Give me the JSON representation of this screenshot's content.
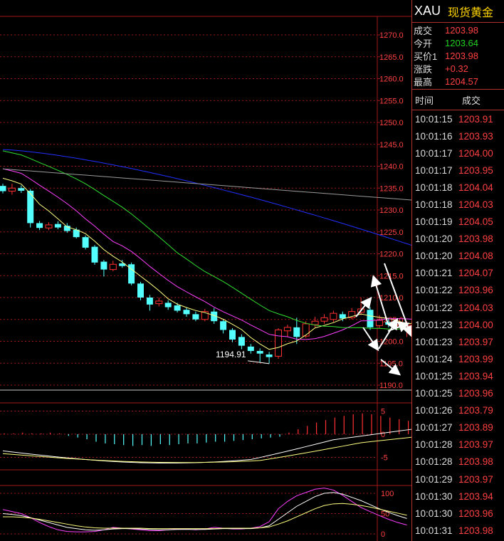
{
  "symbol": "XAU",
  "symbol_name": "现货黄金",
  "quote": [
    {
      "label": "成交",
      "value": "1203.98",
      "color": "#ff4040"
    },
    {
      "label": "今开",
      "value": "1203.64",
      "color": "#21d021"
    },
    {
      "label": "买价1",
      "value": "1203.98",
      "color": "#ff4040"
    },
    {
      "label": "涨跌",
      "value": "+0.32",
      "color": "#ff4040"
    },
    {
      "label": "最高",
      "value": "1204.57",
      "color": "#ff4040"
    }
  ],
  "trades_header": {
    "time": "时间",
    "price": "成交"
  },
  "trades": [
    {
      "time": "10:01:15",
      "price": "1203.91"
    },
    {
      "time": "10:01:16",
      "price": "1203.93"
    },
    {
      "time": "10:01:17",
      "price": "1204.00"
    },
    {
      "time": "10:01:17",
      "price": "1203.95"
    },
    {
      "time": "10:01:18",
      "price": "1204.04"
    },
    {
      "time": "10:01:18",
      "price": "1204.03"
    },
    {
      "time": "10:01:19",
      "price": "1204.05"
    },
    {
      "time": "10:01:20",
      "price": "1203.98"
    },
    {
      "time": "10:01:20",
      "price": "1204.08"
    },
    {
      "time": "10:01:21",
      "price": "1204.07"
    },
    {
      "time": "10:01:22",
      "price": "1203.96"
    },
    {
      "time": "10:01:22",
      "price": "1204.03"
    },
    {
      "time": "10:01:23",
      "price": "1204.00"
    },
    {
      "time": "10:01:23",
      "price": "1203.97"
    },
    {
      "time": "10:01:24",
      "price": "1203.99"
    },
    {
      "time": "10:01:25",
      "price": "1203.94"
    },
    {
      "time": "10:01:25",
      "price": "1203.96"
    },
    {
      "time": "10:01:26",
      "price": "1203.79"
    },
    {
      "time": "10:01:27",
      "price": "1203.89"
    },
    {
      "time": "10:01:28",
      "price": "1203.97"
    },
    {
      "time": "10:01:28",
      "price": "1203.98"
    },
    {
      "time": "10:01:29",
      "price": "1203.97"
    },
    {
      "time": "10:01:30",
      "price": "1203.94"
    },
    {
      "time": "10:01:30",
      "price": "1203.96"
    },
    {
      "time": "10:01:31",
      "price": "1203.98"
    }
  ],
  "chart_data": {
    "type": "candlestick",
    "price_axis": {
      "ticks": [
        "1270.0",
        "1265.0",
        "1260.0",
        "1255.0",
        "1250.0",
        "1245.0",
        "1240.0",
        "1235.0",
        "1230.0",
        "1225.0",
        "1220.0",
        "1215.0",
        "1210.0",
        "1205.0",
        "1200.0",
        "1195.0",
        "1190.0"
      ],
      "range": [
        1190,
        1272
      ]
    },
    "macd_axis": {
      "ticks": [
        "5",
        "0",
        "-5"
      ]
    },
    "kdj_axis": {
      "ticks": [
        "100",
        "50",
        "0"
      ]
    },
    "low_annotation": "1194.91",
    "colors": {
      "up": "#ff3030",
      "down": "#54ffff",
      "ma_yellow": "#ffff80",
      "ma_magenta": "#ff40ff",
      "ma_green": "#30e030",
      "ma_blue": "#2030ff",
      "ma_gray": "#9a9a9a",
      "grid": "#a01818"
    },
    "candles": [
      {
        "o": 1235.5,
        "c": 1234.3,
        "h": 1236.0,
        "l": 1233.8
      },
      {
        "o": 1234.3,
        "c": 1235.0,
        "h": 1236.0,
        "l": 1233.5
      },
      {
        "o": 1235.0,
        "c": 1234.4,
        "h": 1235.6,
        "l": 1233.9
      },
      {
        "o": 1234.4,
        "c": 1227.0,
        "h": 1234.8,
        "l": 1226.0
      },
      {
        "o": 1227.0,
        "c": 1225.9,
        "h": 1227.5,
        "l": 1225.4
      },
      {
        "o": 1225.9,
        "c": 1226.6,
        "h": 1227.2,
        "l": 1225.4
      },
      {
        "o": 1226.8,
        "c": 1226.0,
        "h": 1227.4,
        "l": 1225.6
      },
      {
        "o": 1226.4,
        "c": 1225.2,
        "h": 1227.0,
        "l": 1224.8
      },
      {
        "o": 1225.5,
        "c": 1223.8,
        "h": 1226.0,
        "l": 1223.5
      },
      {
        "o": 1223.8,
        "c": 1221.4,
        "h": 1224.2,
        "l": 1221.0
      },
      {
        "o": 1221.6,
        "c": 1218.0,
        "h": 1222.0,
        "l": 1217.5
      },
      {
        "o": 1218.2,
        "c": 1216.4,
        "h": 1218.6,
        "l": 1214.8
      },
      {
        "o": 1216.4,
        "c": 1217.6,
        "h": 1218.4,
        "l": 1216.0
      },
      {
        "o": 1217.8,
        "c": 1217.2,
        "h": 1218.6,
        "l": 1216.8
      },
      {
        "o": 1217.6,
        "c": 1213.2,
        "h": 1218.0,
        "l": 1212.8
      },
      {
        "o": 1213.2,
        "c": 1210.0,
        "h": 1213.6,
        "l": 1209.4
      },
      {
        "o": 1210.0,
        "c": 1208.4,
        "h": 1210.6,
        "l": 1207.0
      },
      {
        "o": 1208.6,
        "c": 1209.2,
        "h": 1210.0,
        "l": 1208.0
      },
      {
        "o": 1208.8,
        "c": 1207.8,
        "h": 1209.4,
        "l": 1207.2
      },
      {
        "o": 1208.2,
        "c": 1207.0,
        "h": 1208.8,
        "l": 1206.6
      },
      {
        "o": 1207.2,
        "c": 1206.2,
        "h": 1207.8,
        "l": 1205.6
      },
      {
        "o": 1206.2,
        "c": 1205.0,
        "h": 1206.8,
        "l": 1204.6
      },
      {
        "o": 1205.0,
        "c": 1206.8,
        "h": 1207.4,
        "l": 1204.6
      },
      {
        "o": 1206.8,
        "c": 1204.6,
        "h": 1207.6,
        "l": 1204.0
      },
      {
        "o": 1204.6,
        "c": 1202.6,
        "h": 1205.0,
        "l": 1201.8
      },
      {
        "o": 1202.6,
        "c": 1200.4,
        "h": 1203.0,
        "l": 1199.8
      },
      {
        "o": 1201.0,
        "c": 1199.0,
        "h": 1201.6,
        "l": 1198.2
      },
      {
        "o": 1198.8,
        "c": 1197.8,
        "h": 1199.4,
        "l": 1197.2
      },
      {
        "o": 1197.8,
        "c": 1197.2,
        "h": 1198.4,
        "l": 1195.2
      },
      {
        "o": 1197.0,
        "c": 1196.4,
        "h": 1197.6,
        "l": 1194.9
      },
      {
        "o": 1196.6,
        "c": 1202.6,
        "h": 1203.0,
        "l": 1196.0
      },
      {
        "o": 1202.4,
        "c": 1203.2,
        "h": 1203.8,
        "l": 1201.0
      },
      {
        "o": 1203.2,
        "c": 1201.0,
        "h": 1205.4,
        "l": 1199.4
      },
      {
        "o": 1201.2,
        "c": 1204.0,
        "h": 1204.6,
        "l": 1200.8
      },
      {
        "o": 1203.8,
        "c": 1204.6,
        "h": 1205.6,
        "l": 1203.2
      },
      {
        "o": 1204.6,
        "c": 1205.4,
        "h": 1206.2,
        "l": 1204.0
      },
      {
        "o": 1205.0,
        "c": 1206.4,
        "h": 1207.0,
        "l": 1204.4
      },
      {
        "o": 1206.2,
        "c": 1205.2,
        "h": 1206.8,
        "l": 1204.6
      },
      {
        "o": 1205.4,
        "c": 1206.8,
        "h": 1207.6,
        "l": 1205.0
      },
      {
        "o": 1206.6,
        "c": 1207.4,
        "h": 1210.0,
        "l": 1206.0
      },
      {
        "o": 1207.2,
        "c": 1203.2,
        "h": 1207.8,
        "l": 1202.6
      },
      {
        "o": 1203.6,
        "c": 1204.8,
        "h": 1206.0,
        "l": 1203.0
      },
      {
        "o": 1204.4,
        "c": 1203.8,
        "h": 1205.4,
        "l": 1203.2
      },
      {
        "o": 1203.8,
        "c": 1204.2,
        "h": 1205.0,
        "l": 1203.4
      },
      {
        "o": 1203.6,
        "c": 1204.0,
        "h": 1204.6,
        "l": 1201.0
      },
      {
        "o": 1203.8,
        "c": 1204.2,
        "h": 1204.6,
        "l": 1203.4
      }
    ],
    "macd_hist": [
      0.1,
      0.1,
      0.2,
      0.1,
      0.1,
      0.2,
      0.1,
      -0.2,
      -0.4,
      -0.6,
      -0.9,
      -1.1,
      -1.2,
      -1.3,
      -1.4,
      -1.3,
      -1.4,
      -1.2,
      -1.3,
      -1.2,
      -1.1,
      -1.1,
      -1.0,
      -0.9,
      -0.9,
      -0.8,
      -0.7,
      -0.6,
      -0.5,
      -0.4,
      -0.3,
      0.2,
      0.6,
      1.0,
      1.4,
      1.7,
      2.0,
      2.2,
      2.4,
      2.5,
      2.4,
      2.2,
      2.0,
      1.8,
      1.6,
      1.4
    ]
  }
}
